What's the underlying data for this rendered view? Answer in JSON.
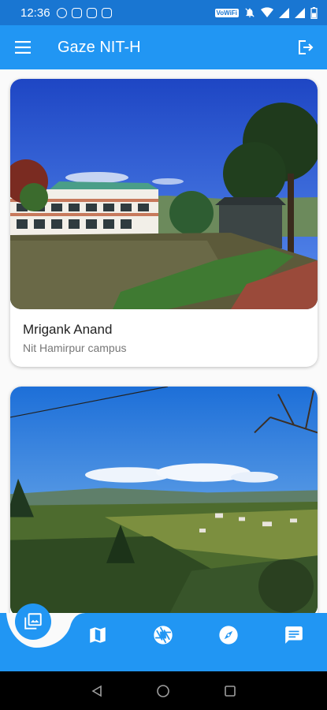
{
  "status_bar": {
    "time": "12:36",
    "network_badge": "VoWiFi",
    "notification_icons": [
      "whatsapp-icon",
      "instagram-icon",
      "instagram-icon",
      "instagram-icon"
    ],
    "system_icons": [
      "vibrate-icon",
      "dnd-icon",
      "wifi-icon",
      "signal-icon",
      "signal-icon",
      "battery-icon"
    ]
  },
  "app_bar": {
    "title": "Gaze NIT-H",
    "menu_icon": "hamburger-menu-icon",
    "action_icon": "logout-icon"
  },
  "feed": {
    "posts": [
      {
        "author": "Mrigank Anand",
        "caption": "Nit Hamirpur campus",
        "image_description_icon": "campus-photo"
      },
      {
        "author": "",
        "caption": "",
        "image_description_icon": "valley-photo"
      }
    ]
  },
  "bottom_nav": {
    "items": [
      {
        "icon": "gallery-icon",
        "active": true
      },
      {
        "icon": "map-icon",
        "active": false
      },
      {
        "icon": "camera-aperture-icon",
        "active": false
      },
      {
        "icon": "compass-icon",
        "active": false
      },
      {
        "icon": "chat-icon",
        "active": false
      }
    ]
  },
  "colors": {
    "primary": "#2196f3",
    "primary_dark": "#1976d2",
    "background": "#fafafa"
  }
}
